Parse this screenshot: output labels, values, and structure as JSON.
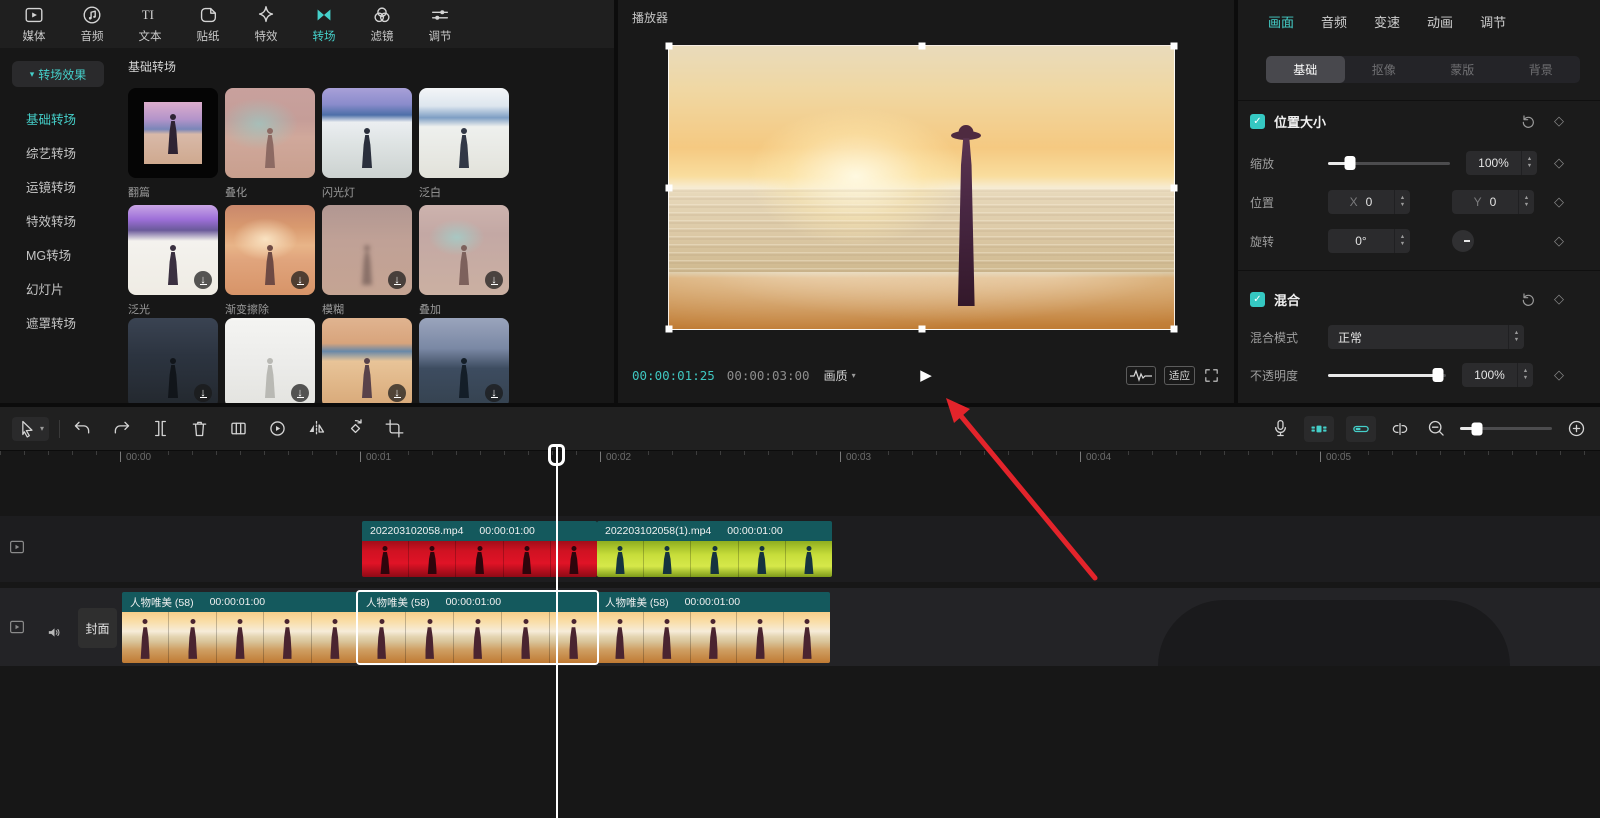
{
  "colors": {
    "accent": "#45d0ca",
    "annotation_red": "#e3242b",
    "clip_header_teal": "#14595d"
  },
  "icons": {
    "caret_down": "▾",
    "check": "✓",
    "download": "↓",
    "keyframe_diamond": "◇",
    "play": "▶",
    "stepper_up": "▲",
    "stepper_down": "▼"
  },
  "top_toolbar": {
    "active": "转场",
    "items": [
      {
        "label": "媒体",
        "icon": "media-icon"
      },
      {
        "label": "音频",
        "icon": "audio-icon"
      },
      {
        "label": "文本",
        "icon": "text-icon"
      },
      {
        "label": "贴纸",
        "icon": "sticker-icon"
      },
      {
        "label": "特效",
        "icon": "effects-icon"
      },
      {
        "label": "转场",
        "icon": "transitions-icon"
      },
      {
        "label": "滤镜",
        "icon": "filters-icon"
      },
      {
        "label": "调节",
        "icon": "adjust-icon"
      }
    ]
  },
  "transitions_panel": {
    "dropdown_label": "转场效果",
    "categories": [
      "基础转场",
      "综艺转场",
      "运镜转场",
      "特效转场",
      "MG转场",
      "幻灯片",
      "遮罩转场"
    ],
    "active_category": "基础转场",
    "section_title": "基础转场",
    "cards": [
      {
        "name": "翻篇",
        "download": false
      },
      {
        "name": "叠化",
        "download": false
      },
      {
        "name": "闪光灯",
        "download": false
      },
      {
        "name": "泛白",
        "download": false
      },
      {
        "name": "泛光",
        "download": true
      },
      {
        "name": "渐变擦除",
        "download": true
      },
      {
        "name": "模糊",
        "download": true
      },
      {
        "name": "叠加",
        "download": true
      },
      {
        "name": "",
        "download": true
      },
      {
        "name": "",
        "download": true
      },
      {
        "name": "",
        "download": true
      },
      {
        "name": "",
        "download": true
      }
    ]
  },
  "player": {
    "title": "播放器",
    "current_time": "00:00:01:25",
    "duration": "00:00:03:00",
    "quality_label": "画质",
    "fit_label": "适应"
  },
  "inspector": {
    "tabs": [
      "画面",
      "音频",
      "变速",
      "动画",
      "调节"
    ],
    "active_tab": "画面",
    "subtabs": [
      "基础",
      "抠像",
      "蒙版",
      "背景"
    ],
    "active_subtab": "基础",
    "position": {
      "title": "位置大小",
      "scale_label": "缩放",
      "scale_value": "100%",
      "pos_label": "位置",
      "x_label": "X",
      "x_value": "0",
      "y_label": "Y",
      "y_value": "0",
      "rotate_label": "旋转",
      "rotate_value": "0°"
    },
    "blend": {
      "title": "混合",
      "mode_label": "混合模式",
      "mode_value": "正常",
      "opacity_label": "不透明度",
      "opacity_value": "100%"
    }
  },
  "timeline": {
    "ruler": [
      "00:00",
      "00:01",
      "00:02",
      "00:03",
      "00:04",
      "00:05"
    ],
    "cover_label": "封面",
    "video_track": [
      {
        "name": "202203102058.mp4",
        "duration": "00:00:01:00"
      },
      {
        "name": "202203102058(1).mp4",
        "duration": "00:00:01:00"
      }
    ],
    "main_track": [
      {
        "name": "人物唯美 (58)",
        "duration": "00:00:01:00"
      },
      {
        "name": "人物唯美 (58)",
        "duration": "00:00:01:00",
        "selected": true
      },
      {
        "name": "人物唯美 (58)",
        "duration": "00:00:01:00"
      }
    ]
  }
}
